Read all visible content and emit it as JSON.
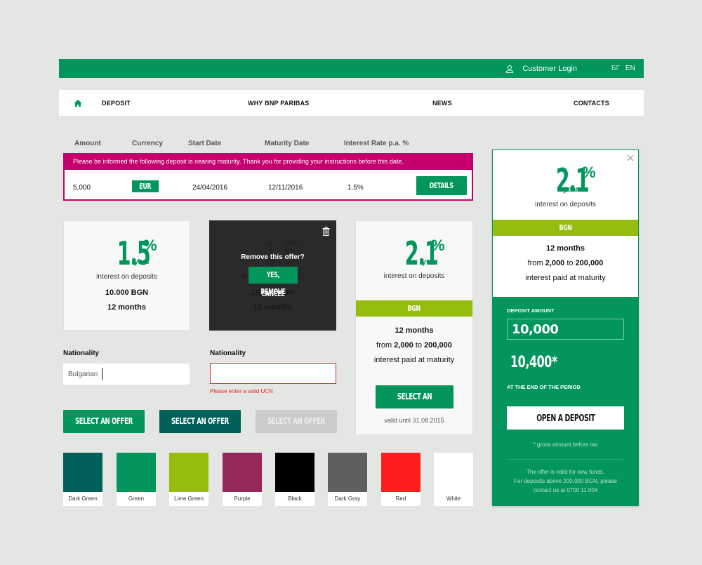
{
  "topbar": {
    "login_icon": "user-icon",
    "login_label": "Customer Login",
    "languages": [
      "БГ",
      "EN"
    ],
    "active_language": "EN",
    "color": "#02955c"
  },
  "nav": {
    "home_icon": "home-icon",
    "items": [
      "DEPOSIT",
      "WHY BNP PARIBAS",
      "NEWS",
      "CONTACTS"
    ]
  },
  "deposit_table": {
    "headers": [
      "Amount",
      "Currency",
      "Start Date",
      "Maturity Date",
      "Interest Rate p.a. %"
    ],
    "notice": "Please be informed the following deposit is nearing maturity. Thank you for providing your instructions before this date.",
    "row": {
      "amount": "5,000",
      "currency": "EUR",
      "start_date": "24/04/2016",
      "maturity_date": "12/11/2016",
      "rate": "1.5%",
      "action": "DETAILS"
    },
    "notice_color": "#c5006e"
  },
  "offer_card_1": {
    "rate": "1.5",
    "percent": "%",
    "period": "year",
    "caption": "interest on deposits",
    "amount": "10.000 BGN",
    "term": "12 months"
  },
  "offer_card_2": {
    "rate": "1.5",
    "percent": "%",
    "period": "year",
    "caption": "interest on deposits",
    "amount": "10.000 BGN",
    "term": "12 months",
    "overlay": {
      "question": "Remove this offer?",
      "confirm": "YES, REMOVE",
      "cancel": "CANCEL",
      "icon": "trash-icon"
    }
  },
  "offer_card_3": {
    "rate": "2.1",
    "percent": "%",
    "period": "year",
    "caption": "interest on deposits",
    "currency": "BGN",
    "term": "12 months",
    "range_from_word": "from",
    "range_from": "2,000",
    "range_to_word": "to",
    "range_to": "200,000",
    "payout": "interest paid at maturity",
    "button": "SELECT AN OFFER",
    "valid_until": "valid until  31.08.2015"
  },
  "form": {
    "field_1": {
      "label": "Nationality",
      "value": "Bulgarian"
    },
    "field_2": {
      "label": "Nationality",
      "value": "",
      "error": "Please enter a valid UCN"
    }
  },
  "buttons": {
    "primary": "SELECT AN OFFER",
    "dark": "SELECT AN OFFER",
    "disabled": "SELECT AN OFFER"
  },
  "palette": [
    {
      "name": "Dark Green",
      "hex": "#01605a"
    },
    {
      "name": "Green",
      "hex": "#02955c"
    },
    {
      "name": "Lime Green",
      "hex": "#95bd0d"
    },
    {
      "name": "Purple",
      "hex": "#95285a"
    },
    {
      "name": "Black",
      "hex": "#000000"
    },
    {
      "name": "Dark Gray",
      "hex": "#5f5f5f"
    },
    {
      "name": "Red",
      "hex": "#ff1e1e"
    },
    {
      "name": "White",
      "hex": "#ffffff"
    }
  ],
  "calculator": {
    "rate": "2.1",
    "percent": "%",
    "period": "year",
    "caption": "interest on deposits",
    "currency": "BGN",
    "term": "12 months",
    "range_from_word": "from",
    "range_from": "2,000",
    "range_to_word": "to",
    "range_to": "200,000",
    "payout": "interest paid at maturity",
    "deposit_label": "DEPOSIT AMOUNT",
    "deposit_value": "10,000",
    "result": "10,400*",
    "result_label": "AT THE END OF THE PERIOD",
    "button": "OPEN A DEPOSIT",
    "footnote": "* gross amount before tax",
    "note_lines": [
      "The offer is valid for new funds.",
      "For deposits above 200,000 BGN, please",
      "contact us at 0700 11 004"
    ]
  }
}
